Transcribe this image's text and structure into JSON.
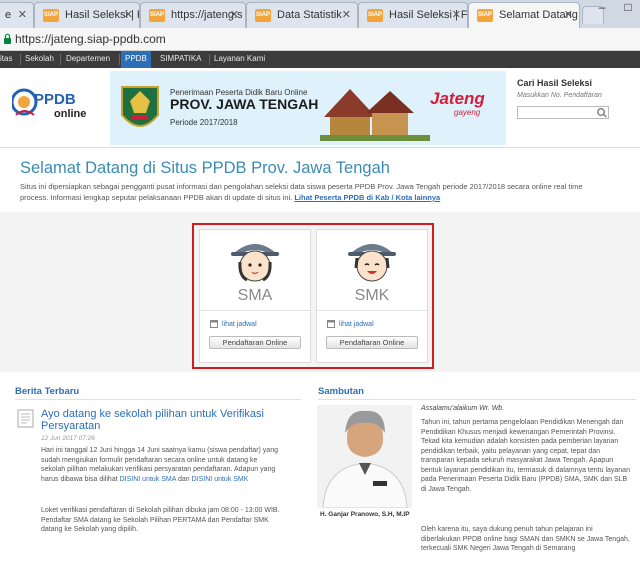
{
  "browser": {
    "tabs": [
      {
        "favicon": "SIAP",
        "title": "e"
      },
      {
        "favicon": "SIAP",
        "title": "Hasil Seleksi | P"
      },
      {
        "favicon": "SIAP",
        "title": "https://jateng.s"
      },
      {
        "favicon": "SIAP",
        "title": "Data Statistik"
      },
      {
        "favicon": "SIAP",
        "title": "Hasil Seleksi | F"
      },
      {
        "favicon": "SIAP",
        "title": "Selamat Datang"
      }
    ],
    "window_controls": {
      "minimize": "–",
      "maximize": "□"
    },
    "url": "https://jateng.siap-ppdb.com"
  },
  "nav": {
    "items": [
      "itas",
      "Sekolah",
      "Departemen",
      "PPDB",
      "SIMPATIKA",
      "Layanan Kami"
    ],
    "active": "PPDB"
  },
  "header": {
    "logo_main": "PPDB",
    "logo_sub": "online",
    "banner_subtitle": "Penerimaan Peserta Didik Baru Online",
    "banner_title": "PROV. JAWA TENGAH",
    "banner_period": "Periode 2017/2018",
    "brand": "Jateng",
    "brand_tagline": "gayeng"
  },
  "search": {
    "title": "Cari Hasil Seleksi",
    "hint": "Masukkan No. Pendaftaran",
    "value": ""
  },
  "welcome": {
    "title": "Selamat Datang di Situs PPDB Prov. Jawa Tengah",
    "text": "Situs ini dipersiapkan sebagai pengganti pusat informasi dan pengolahan seleksi data siswa peserta PPDB Prov. Jawa Tengah periode 2017/2018 secara online real time process. Informasi lengkap seputar pelaksanaan PPDB akan di update di situs ini.",
    "link": "Lihat Peserta PPDB di Kab / Kota lainnya"
  },
  "cards": [
    {
      "label": "SMA",
      "schedule_link": "lihat jadwal",
      "button": "Pendaftaran Online"
    },
    {
      "label": "SMK",
      "schedule_link": "lihat jadwal",
      "button": "Pendaftaran Online"
    }
  ],
  "news": {
    "section_title": "Berita Terbaru",
    "title": "Ayo datang ke sekolah pilihan untuk Verifikasi Persyaratan",
    "date": "12 Jun 2017 07:26",
    "p1_a": "Hari ini tanggal 12 Juni hingga 14 Juni saatnya kamu (siswa pendaftar) yang sudah mengisikan formulir pendaftaran secara online untuk datang ke sekolah pilihan melakukan verifikasi persyaratan pendaftaran. Adapun yang harus dibawa bisa dilihat",
    "p1_link1": "DISINI untuk SMA",
    "p1_and": "dan",
    "p1_link2": "DISINI untuk SMK",
    "p2": "Loket verifikasi pendaftaran di Sekolah pilihan dibuka jam 08:00 - 13:00 WIB. Pendaftar SMA datang ke Sekolah Pilihan PERTAMA dan Pendaftar SMK datang ke Sekolah yang dipilih."
  },
  "sambutan": {
    "section_title": "Sambutan",
    "salam": "Assalamu'alaikum Wr. Wb.",
    "p1": "Tahun ini, tahun pertama pengelolaan Pendidikan Menengah dan Pendidikan Khusus menjadi kewenangan Pemerintah Provinsi. Tekad kita kemudian adalah konsisten pada pemberian layanan pendidikan terbaik, yaitu pelayanan yang cepat, tepat dan transparan kepada seluruh masyarakat Jawa Tengah. Apapun bentuk layanan pendidikan itu, termasuk di dalamnya tentu layanan pada Penerimaan Peserta Didik Baru (PPDB) SMA, SMK dan SLB di Jawa Tengah.",
    "p2": "Oleh karena itu, saya dukung penuh tahun pelajaran ini diberlakukan PPDB online bagi SMAN dan SMKN se Jawa Tengah, terkecuali SMK Negeri Jawa Tengah di Semarang",
    "photo_caption": "H. Ganjar Pranowo, S.H, M.IP"
  }
}
